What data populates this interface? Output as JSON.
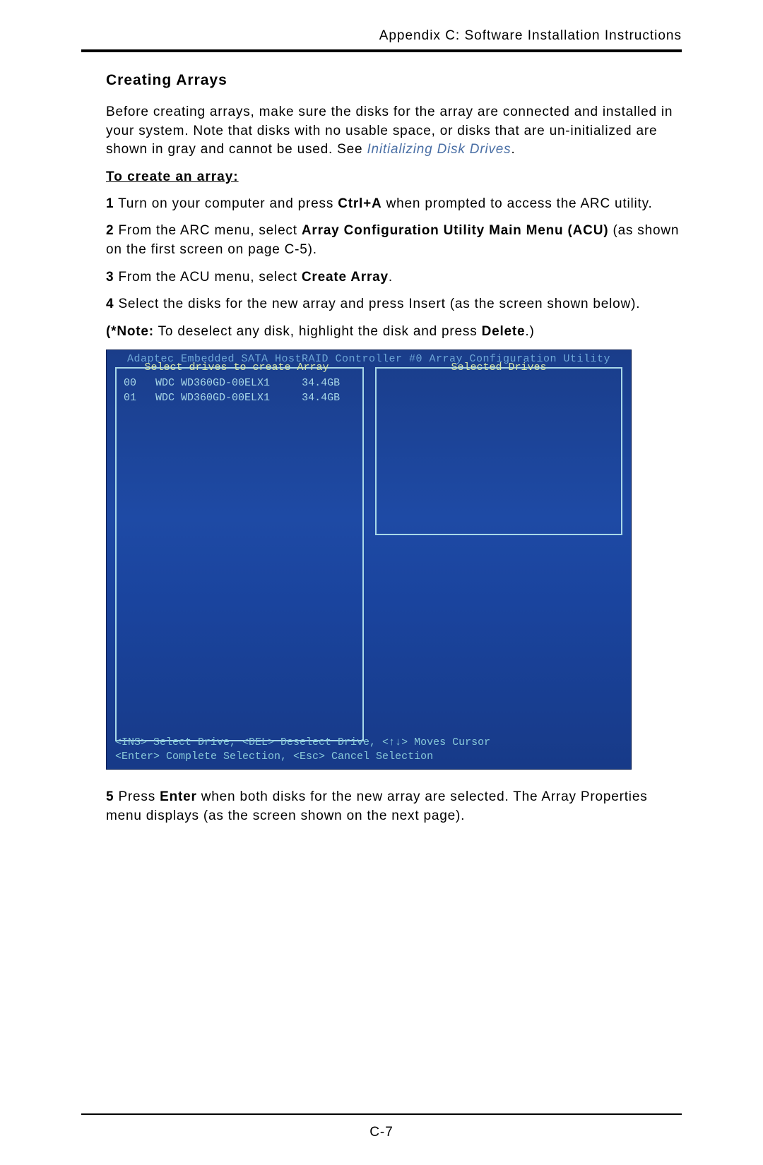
{
  "header": "Appendix C: Software Installation Instructions",
  "section_title": "Creating Arrays",
  "intro": {
    "part1": "Before creating arrays, make sure the disks for the array are connected and installed in your system. Note that disks with no usable space, or disks that are un-initialized are shown in gray and cannot be used. See ",
    "link": "Initializing Disk Drives",
    "part2": "."
  },
  "subhead": "To create an array:",
  "steps": {
    "s1": {
      "num": "1",
      "a": " Turn on your computer and press ",
      "b": "Ctrl+A",
      "c": " when prompted to access the ARC utility."
    },
    "s2": {
      "num": "2",
      "a": " From the ARC menu, select ",
      "b": "Array Configuration Utility Main Menu (ACU)",
      "c": " (as shown on the first screen on page C-5)."
    },
    "s3": {
      "num": "3",
      "a": " From the ACU menu, select ",
      "b": "Create Array",
      "c": "."
    },
    "s4": {
      "num": "4",
      "a": " Select the disks for the new array and press Insert (as the screen shown below)."
    },
    "note": {
      "label": "(*Note:",
      "text": " To deselect any disk, highlight the disk and press ",
      "b": "Delete",
      "end": ".)"
    },
    "s5": {
      "num": "5",
      "a": " Press ",
      "b": "Enter",
      "c": " when both disks for the new array are selected. The Array Properties menu displays (as the screen shown on the next page)."
    }
  },
  "bios": {
    "title": "Adaptec Embedded SATA HostRAID Controller #0 Array Configuration Utility",
    "left_title": "Select drives to create Array",
    "right_title": "Selected Drives",
    "drives": [
      {
        "id": "00",
        "model": "WDC WD360GD-00ELX1",
        "size": "34.4GB"
      },
      {
        "id": "01",
        "model": "WDC WD360GD-00ELX1",
        "size": "34.4GB"
      }
    ],
    "footer1": "<INS> Select Drive, <DEL> Deselect Drive, <↑↓> Moves Cursor",
    "footer2": "<Enter> Complete Selection, <Esc> Cancel Selection"
  },
  "page_num": "C-7"
}
